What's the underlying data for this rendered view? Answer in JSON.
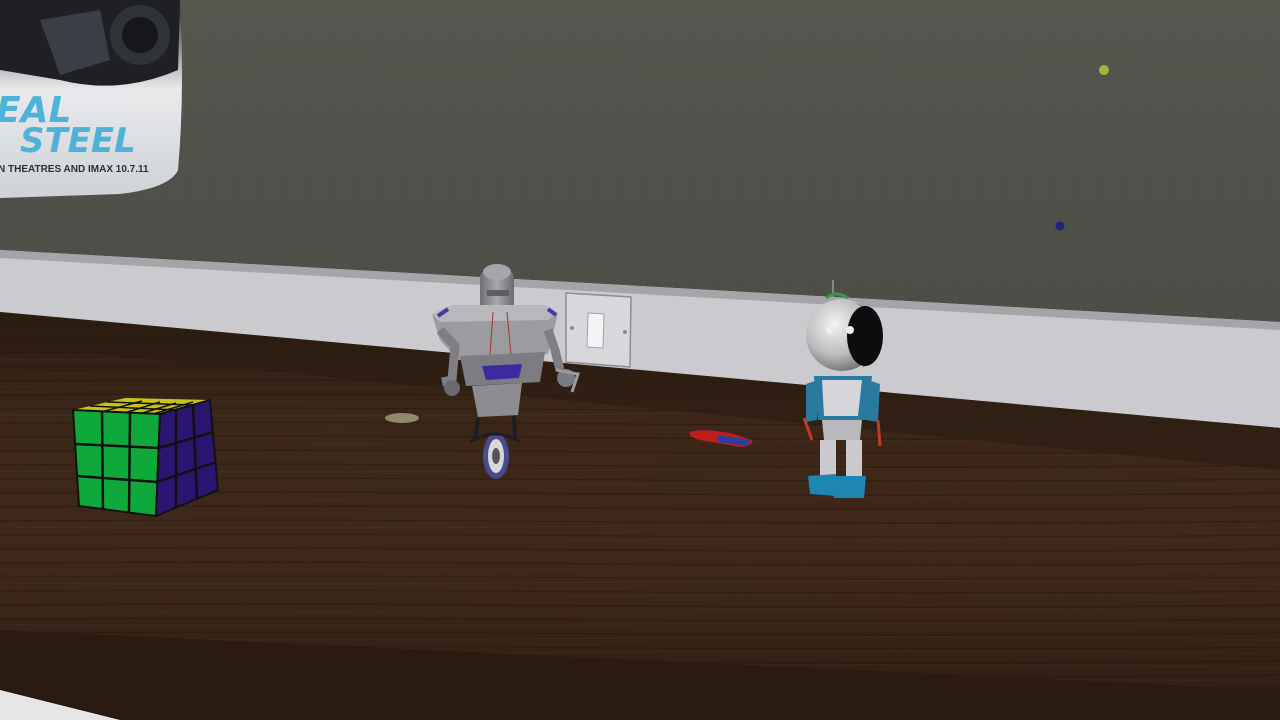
{
  "poster": {
    "title_line1": "EAL",
    "title_line2": "STEEL",
    "tagline": "N THEATRES AND IMAX 10.7.11"
  },
  "colors": {
    "wall": "#50524b",
    "baseboard": "#c9c9cd",
    "desk": "#3a2416",
    "poster_text": "#4fb3d9",
    "cube_green": "#0fa83a",
    "cube_yellow": "#c8c21a",
    "cube_purple": "#2a1670",
    "robot_grey": "#8d8d91",
    "robot_blue": "#2a7aa0",
    "pin_yellow": "#a7b23c",
    "pin_blue": "#23237a"
  }
}
